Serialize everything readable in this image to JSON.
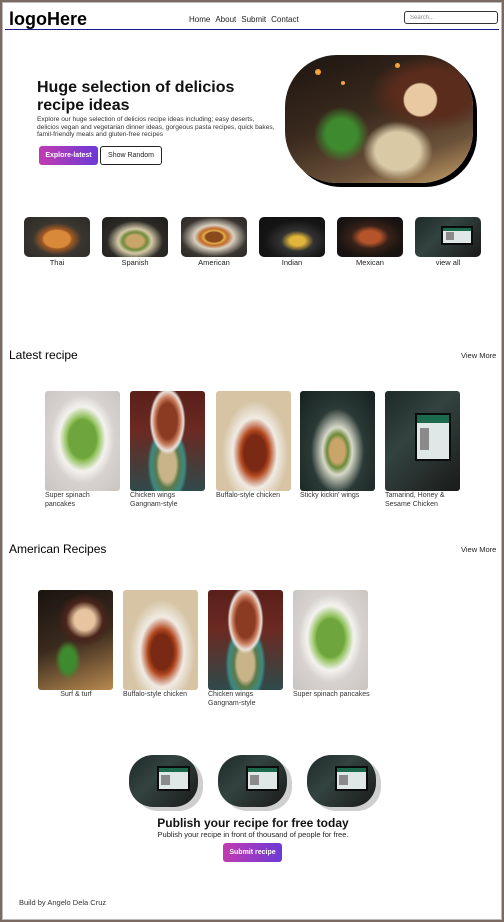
{
  "header": {
    "logo": "logoHere",
    "nav": [
      "Home",
      "About",
      "Submit",
      "Contact"
    ],
    "search_placeholder": "Search..."
  },
  "hero": {
    "title": "Huge selection of delicios recipe ideas",
    "text": "Explore our huge selection of delicios recipe ideas including; easy deserts, delicios vegan and vegetarian dinner ideas, gorgeous pasta recipes, quick bakes, famil-friendly meals and gluten-free recipes",
    "explore_label": "Explore-latest",
    "random_label": "Show Random"
  },
  "categories": [
    {
      "label": "Thai",
      "image": "curry-bowl"
    },
    {
      "label": "Spanish",
      "image": "tacos"
    },
    {
      "label": "American",
      "image": "burger"
    },
    {
      "label": "Indian",
      "image": "curry-dark"
    },
    {
      "label": "Mexican",
      "image": "burger-stack"
    },
    {
      "label": "view all",
      "image": "laptop"
    }
  ],
  "latest": {
    "title": "Latest recipe",
    "view_more": "View More",
    "items": [
      {
        "label": "Super spinach pancakes",
        "image": "spinach-pancakes"
      },
      {
        "label": "Chicken wings Gangnam-style",
        "image": "chicken-wings"
      },
      {
        "label": "Buffalo-style chicken",
        "image": "buffalo-chicken"
      },
      {
        "label": "Sticky kickin' wings",
        "image": "sticky-wings"
      },
      {
        "label": "Tamarind, Honey & Sesame Chicken",
        "image": "laptop"
      }
    ]
  },
  "american": {
    "title": "American Recipes",
    "view_more": "View More",
    "items": [
      {
        "label": "Surf & turf",
        "image": "surf-turf"
      },
      {
        "label": "Buffalo-style chicken",
        "image": "buffalo-chicken"
      },
      {
        "label": "Chicken wings Gangnam-style",
        "image": "chicken-wings"
      },
      {
        "label": "Super spinach pancakes",
        "image": "spinach-pancakes"
      }
    ]
  },
  "publish": {
    "title": "Publish your recipe for free today",
    "text": "Publish your recipe in front of thousand of people for free.",
    "button": "Submit recipe"
  },
  "footer": "Build by Angelo Dela Cruz",
  "colors": {
    "accent_gradient_start": "#c13bb0",
    "accent_gradient_end": "#6c3ad6",
    "header_rule": "#1a1a8c"
  }
}
